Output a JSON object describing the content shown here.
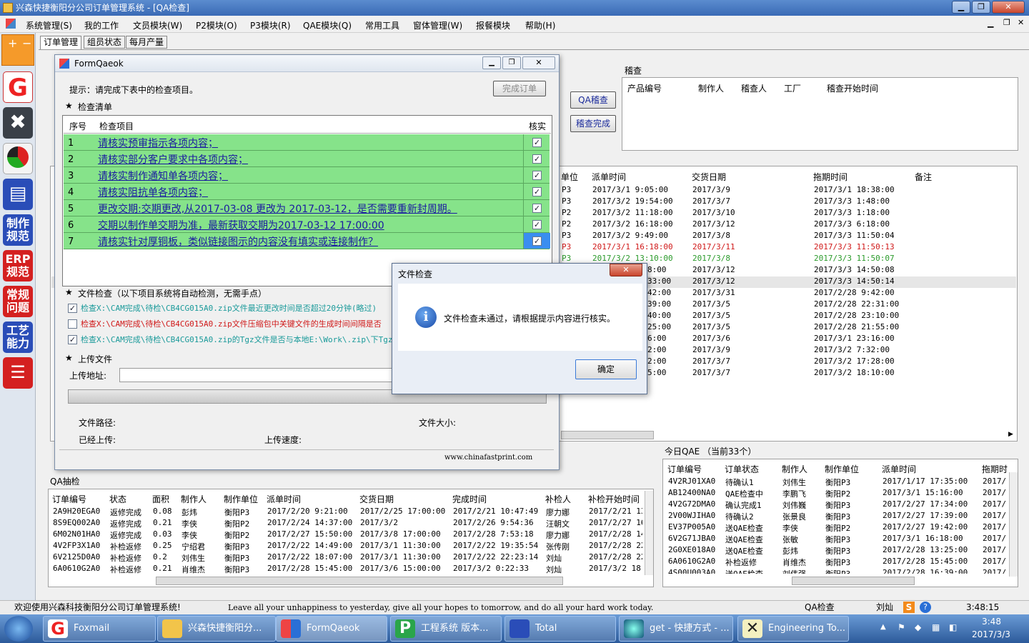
{
  "window": {
    "title": "兴森快捷衡阳分公司订单管理系统 - [QA检查]"
  },
  "menu": [
    "系统管理(S)",
    "我的工作",
    "文员模块(W)",
    "P2模块(O)",
    "P3模块(R)",
    "QAE模块(Q)",
    "常用工具",
    "窗体管理(W)",
    "报餐模块",
    "帮助(H)"
  ],
  "left_toolbar": {
    "erp": "ERP\n规范",
    "zhizuo": "制作\n规范",
    "changgui": "常规\n问题",
    "gongyi": "工艺\n能力"
  },
  "tabs": [
    "订单管理",
    "组员状态",
    "每月产量"
  ],
  "bg": {
    "inspect_title": "稽查",
    "inspect_headers": [
      "产品编号",
      "制作人",
      "稽查人",
      "工厂",
      "稽查开始时间"
    ],
    "qa_button": "QA稽查",
    "done_button": "稽查完成",
    "main_headers": [
      "单位",
      "派单时间",
      "交货日期",
      "拖期时间",
      "备注"
    ],
    "main_rows": [
      {
        "unit": "P3",
        "dispatch": "2017/3/1 9:05:00",
        "delivery": "2017/3/9",
        "delay": "2017/3/1 18:38:00",
        "red": false
      },
      {
        "unit": "P3",
        "dispatch": "2017/3/2 19:54:00",
        "delivery": "2017/3/7",
        "delay": "2017/3/3 1:48:00",
        "red": false
      },
      {
        "unit": "P2",
        "dispatch": "2017/3/2 11:18:00",
        "delivery": "2017/3/10",
        "delay": "2017/3/3 1:18:00",
        "red": false
      },
      {
        "unit": "P2",
        "dispatch": "2017/3/2 16:18:00",
        "delivery": "2017/3/12",
        "delay": "2017/3/3 6:18:00",
        "red": false
      },
      {
        "unit": "P3",
        "dispatch": "2017/3/2 9:49:00",
        "delivery": "2017/3/8",
        "delay": "2017/3/3 11:50:04",
        "red": false
      },
      {
        "unit": "P3",
        "dispatch": "2017/3/1 16:18:00",
        "delivery": "2017/3/11",
        "delay": "2017/3/3 11:50:13",
        "red": true
      },
      {
        "unit": "P3",
        "dispatch": "2017/3/2 13:10:00",
        "delivery": "2017/3/8",
        "delay": "2017/3/3 11:50:07",
        "red": false,
        "green": true
      },
      {
        "unit": "",
        "dispatch": "8:00",
        "delivery": "2017/3/12",
        "delay": "2017/3/3 14:50:08",
        "red": false
      },
      {
        "unit": "",
        "dispatch": "33:00",
        "delivery": "2017/3/12",
        "delay": "2017/3/3 14:50:14",
        "red": false
      },
      {
        "unit": "",
        "dispatch": "42:00",
        "delivery": "2017/3/31",
        "delay": "2017/2/28 9:42:00",
        "red": false
      },
      {
        "unit": "",
        "dispatch": "39:00",
        "delivery": "2017/3/5",
        "delay": "2017/2/28 22:31:00",
        "red": false
      },
      {
        "unit": "",
        "dispatch": "40:00",
        "delivery": "2017/3/5",
        "delay": "2017/2/28 23:10:00",
        "red": false
      },
      {
        "unit": "",
        "dispatch": "25:00",
        "delivery": "2017/3/5",
        "delay": "2017/2/28 21:55:00",
        "red": false
      },
      {
        "unit": "",
        "dispatch": "6:00",
        "delivery": "2017/3/6",
        "delay": "2017/3/1 23:16:00",
        "red": false
      },
      {
        "unit": "",
        "dispatch": "2:00",
        "delivery": "2017/3/9",
        "delay": "2017/3/2 7:32:00",
        "red": false
      },
      {
        "unit": "",
        "dispatch": "2:00",
        "delivery": "2017/3/7",
        "delay": "2017/3/2 17:28:00",
        "red": false
      },
      {
        "unit": "",
        "dispatch": "5:00",
        "delivery": "2017/3/7",
        "delay": "2017/3/2 18:10:00",
        "red": false
      }
    ],
    "today_qae_title": "今日QAE  （当前33个）",
    "today_headers": [
      "订单编号",
      "订单状态",
      "制作人",
      "制作单位",
      "派单时间",
      "拖期时"
    ],
    "today_rows": [
      [
        "4V2RJ01XA0",
        "待确认1",
        "刘伟生",
        "衡阳P3",
        "2017/1/17 17:35:00",
        "2017/"
      ],
      [
        "AB12400NA0",
        "QAE检查中",
        "李鹏飞",
        "衡阳P2",
        "2017/3/1 15:16:00",
        "2017/"
      ],
      [
        "4V2G72DMA0",
        "确认完成1",
        "刘伟巍",
        "衡阳P3",
        "2017/2/27 17:34:00",
        "2017/"
      ],
      [
        "2V00WJIHA0",
        "待确认2",
        "张景良",
        "衡阳P3",
        "2017/2/27 17:39:00",
        "2017/"
      ],
      [
        "EV37P005A0",
        "送QAE检查",
        "李侠",
        "衡阳P2",
        "2017/2/27 19:42:00",
        "2017/"
      ],
      [
        "6V2G71JBA0",
        "送QAE检查",
        "张敏",
        "衡阳P3",
        "2017/3/1 16:18:00",
        "2017/"
      ],
      [
        "2G0XE018A0",
        "送QAE检查",
        "彭炜",
        "衡阳P3",
        "2017/2/28 13:25:00",
        "2017/"
      ],
      [
        "6A0610G2A0",
        "补检返修",
        "肖维杰",
        "衡阳P3",
        "2017/2/28 15:45:00",
        "2017/"
      ],
      [
        "4S00U003A0",
        "送QAE检查",
        "刘伟强",
        "衡阳P3",
        "2017/2/28 16:39:00",
        "2017/"
      ]
    ],
    "qa_title": "QA抽检",
    "qa_headers": [
      "订单编号",
      "状态",
      "面积",
      "制作人",
      "制作单位",
      "派单时间",
      "交货日期",
      "完成时间",
      "补检人",
      "补检开始时间"
    ],
    "qa_rows": [
      [
        "2A9H20EGA0",
        "返修完成",
        "0.08",
        "彭炜",
        "衡阳P3",
        "2017/2/20 9:21:00",
        "2017/2/25 17:00:00",
        "2017/2/21 10:47:49",
        "廖力娜",
        "2017/2/21 13"
      ],
      [
        "8S9EQ002A0",
        "返修完成",
        "0.21",
        "李侠",
        "衡阳P2",
        "2017/2/24 14:37:00",
        "2017/3/2",
        "2017/2/26 9:54:36",
        "汪朝文",
        "2017/2/27 16"
      ],
      [
        "6M02N01HA0",
        "返修完成",
        "0.03",
        "李侠",
        "衡阳P2",
        "2017/2/27 15:50:00",
        "2017/3/8 17:00:00",
        "2017/2/28 7:53:18",
        "廖力娜",
        "2017/2/28 14"
      ],
      [
        "4V2FP3X1A0",
        "补检返修",
        "0.25",
        "宁绍君",
        "衡阳P3",
        "2017/2/22 14:49:00",
        "2017/3/1 11:30:00",
        "2017/2/22 19:35:54",
        "张传刚",
        "2017/2/28 22"
      ],
      [
        "6V2125D0A0",
        "补检返修",
        "0.2",
        "刘伟生",
        "衡阳P3",
        "2017/2/22 18:07:00",
        "2017/3/1 11:30:00",
        "2017/2/22 22:23:14",
        "刘灿",
        "2017/2/28 22"
      ],
      [
        "6A0610G2A0",
        "补检返修",
        "0.21",
        "肖维杰",
        "衡阳P3",
        "2017/2/28 15:45:00",
        "2017/3/6 15:00:00",
        "2017/3/2 0:22:33",
        "刘灿",
        "2017/3/2 18:"
      ]
    ]
  },
  "form": {
    "title": "FormQaeok",
    "hint": "提示：请完成下表中的检查项目。",
    "complete_button": "完成订单",
    "checklist_title": "检查清单",
    "col_no": "序号",
    "col_item": "检查项目",
    "col_verify": "核实",
    "items": [
      {
        "no": "1",
        "text": "请核实预审指示各项内容；",
        "checked": true
      },
      {
        "no": "2",
        "text": "请核实部分客户要求中各项内容；",
        "checked": true
      },
      {
        "no": "3",
        "text": "请核实制作通知单各项内容；",
        "checked": true
      },
      {
        "no": "4",
        "text": "请核实阻抗单各项内容；",
        "checked": true
      },
      {
        "no": "5",
        "text": "更改交期:交期更改,从2017-03-08 更改为 2017-03-12，是否需要重新封周期。",
        "checked": true
      },
      {
        "no": "6",
        "text": "交期以制作单交期为准，最新获取交期为2017-03-12 17:00:00",
        "checked": true
      },
      {
        "no": "7",
        "text": "请核实针对厚铜板，类似链接图示的内容没有填实或连接制作？",
        "checked": true
      }
    ],
    "file_check_title": "文件检查（以下项目系统将自动检测，无需手点）",
    "file_checks": [
      {
        "text": "检查X:\\CAM完成\\待检\\CB4CG015A0.zip文件最近更改时间是否超过20分钟(略过)",
        "color": "#1a9a9a",
        "checked": true
      },
      {
        "text": "检查X:\\CAM完成\\待检\\CB4CG015A0.zip文件压缩包中关键文件的生成时间间隔是否",
        "color": "#d01818",
        "checked": false
      },
      {
        "text": "检查X:\\CAM完成\\待检\\CB4CG015A0.zip的Tgz文件是否与本地E:\\Work\\.zip\\下Tgz文",
        "color": "#1a9a9a",
        "checked": true
      }
    ],
    "upload_title": "上传文件",
    "upload_addr_label": "上传地址:",
    "file_path_label": "文件路径:",
    "file_size_label": "文件大小:",
    "uploaded_label": "已经上传:",
    "upload_speed_label": "上传速度:",
    "footer_url": "www.chinafastprint.com"
  },
  "dialog": {
    "title": "文件检查",
    "message": "文件检查未通过，请根据提示内容进行核实。",
    "ok": "确定"
  },
  "status": {
    "welcome": "欢迎使用兴森科技衡阳分公司订单管理系统!",
    "motto": "Leave all your unhappiness to yesterday, give all your hopes to tomorrow, and do all your hard work today.",
    "module": "QA检查",
    "user": "刘灿",
    "time": "3:48:15"
  },
  "taskbar": {
    "tasks": [
      "Foxmail",
      "兴森快捷衡阳分...",
      "FormQaeok",
      "工程系统  版本...",
      "Total Command...",
      "get - 快捷方式 - ...",
      "Engineering To..."
    ],
    "clock_time": "3:48",
    "clock_date": "2017/3/3"
  },
  "colors": {
    "checklist_green": "#86e38a",
    "link_blue": "#1a1aa0",
    "alert_red": "#d01818",
    "teal": "#1a9a9a"
  }
}
